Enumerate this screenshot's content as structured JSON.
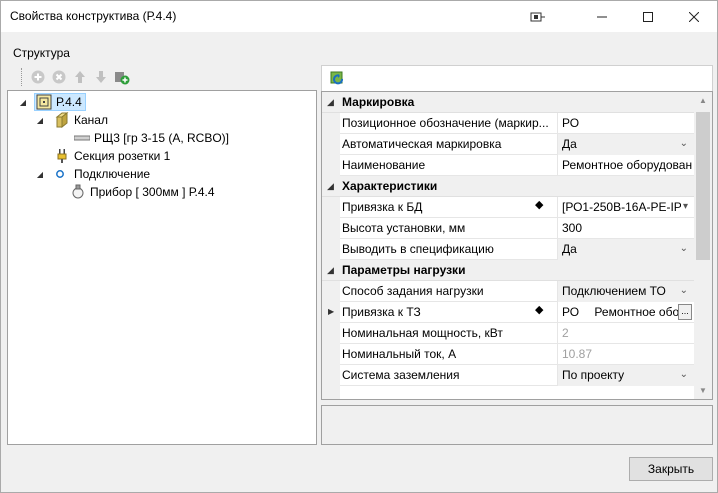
{
  "window": {
    "title": "Свойства конструктива (Р.4.4)"
  },
  "group_label": "Структура",
  "tree": {
    "root": "Р.4.4",
    "kanal": "Канал",
    "rsh": "РЩ3 [гр 3-15 (А, RCBO)]",
    "sekcia": "Секция розетки 1",
    "podkl": "Подключение",
    "pribor": "Прибор [ 300мм ] Р.4.4"
  },
  "properties": {
    "cat1": "Маркировка",
    "p_pos_name": "Позиционное обозначение (маркир...",
    "p_pos_val": "РО",
    "p_auto_name": "Автоматическая маркировка",
    "p_auto_val": "Да",
    "p_naim_name": "Наименование",
    "p_naim_val": "Ремонтное оборудован",
    "cat2": "Характеристики",
    "p_bd_name": "Привязка к БД",
    "p_bd_val": "[РО1-250В-16А-РЕ-IP",
    "p_h_name": "Высота установки, мм",
    "p_h_val": "300",
    "p_spec_name": "Выводить в спецификацию",
    "p_spec_val": "Да",
    "cat3": "Параметры нагрузки",
    "p_sposob_name": "Способ задания нагрузки",
    "p_sposob_val": "Подключением ТО",
    "p_tz_name": "Привязка к ТЗ",
    "p_tz_val": "РО",
    "p_tz_val2": "Ремонтное обор",
    "p_pow_name": "Номинальная мощность, кВт",
    "p_pow_val": "2",
    "p_cur_name": "Номинальный ток, А",
    "p_cur_val": "10.87",
    "p_sys_name": "Система заземления",
    "p_sys_val": "По проекту"
  },
  "buttons": {
    "close": "Закрыть",
    "ellipsis": "..."
  },
  "colors": {
    "selection": "#cce8ff",
    "category": "#f0f0f0"
  }
}
